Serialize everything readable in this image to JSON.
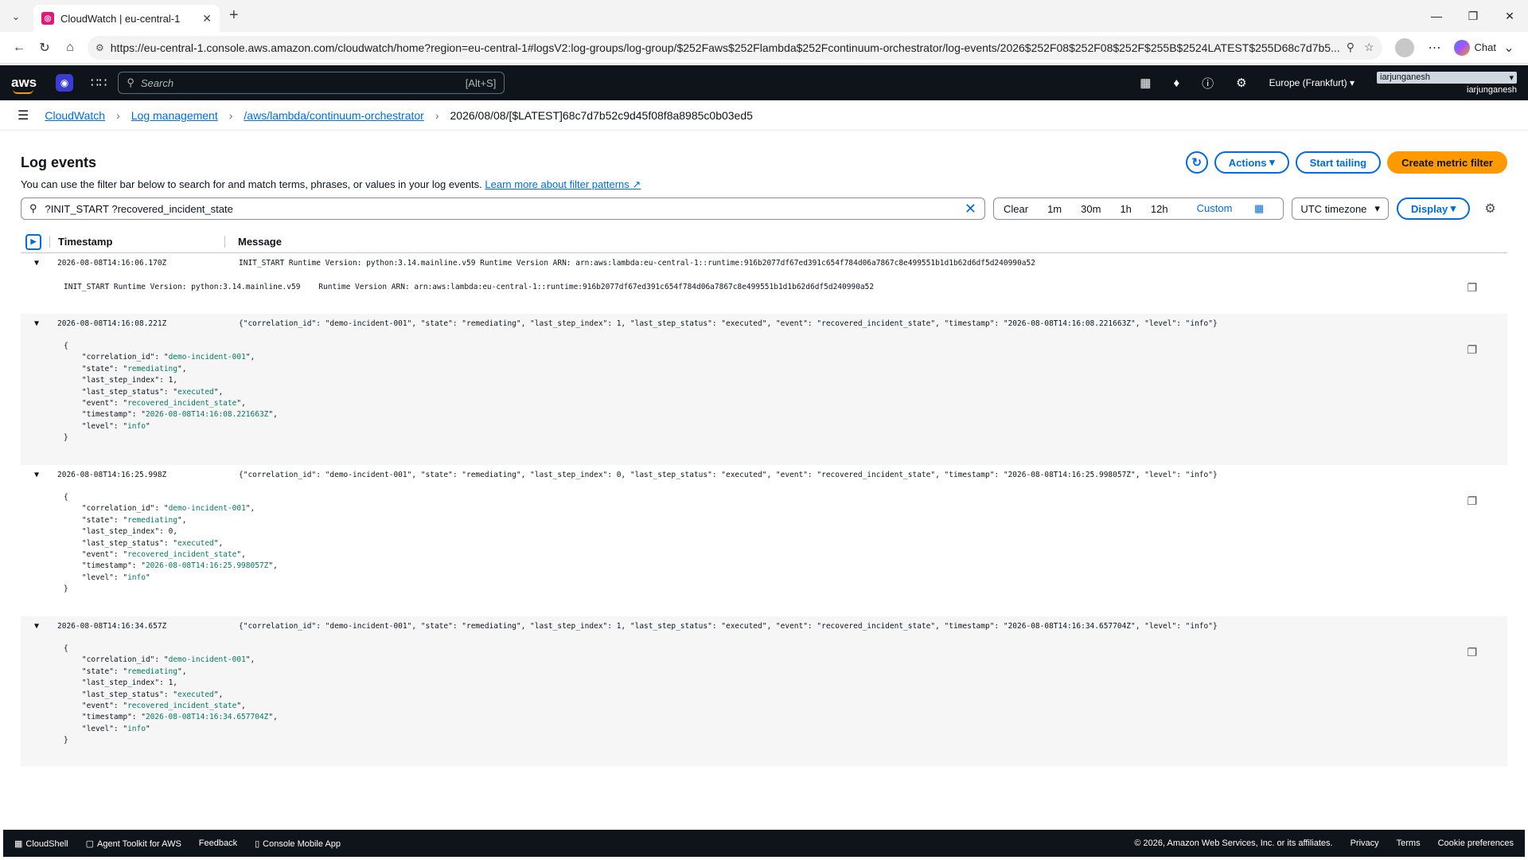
{
  "browser": {
    "tab_title": "CloudWatch | eu-central-1",
    "url": "https://eu-central-1.console.aws.amazon.com/cloudwatch/home?region=eu-central-1#logsV2:log-groups/log-group/$252Faws$252Flambda$252Fcontinuum-orchestrator/log-events/2026$252F08$252F08$252F$255B$2524LATEST$255D68c7d7b5...",
    "chat_label": "Chat"
  },
  "aws": {
    "logo": "aws",
    "search_placeholder": "Search",
    "search_hint": "[Alt+S]",
    "region": "Europe (Frankfurt)",
    "account_badge": "iarjunganesh",
    "account_name": "iarjunganesh"
  },
  "breadcrumb": {
    "items": [
      "CloudWatch",
      "Log management",
      "/aws/lambda/continuum-orchestrator"
    ],
    "current": "2026/08/08/[$LATEST]68c7d7b52c9d45f08f8a8985c0b03ed5"
  },
  "page": {
    "title": "Log events",
    "description": "You can use the filter bar below to search for and match terms, phrases, or values in your log events.",
    "learn_more": "Learn more about filter patterns",
    "actions_label": "Actions",
    "start_tailing_label": "Start tailing",
    "create_metric_label": "Create metric filter",
    "filter_value": "?INIT_START ?recovered_incident_state",
    "time_options": [
      "Clear",
      "1m",
      "30m",
      "1h",
      "12h"
    ],
    "custom_label": "Custom",
    "timezone_label": "UTC timezone",
    "display_label": "Display",
    "col_timestamp": "Timestamp",
    "col_message": "Message"
  },
  "events": [
    {
      "timestamp": "2026-08-08T14:16:06.170Z",
      "message": "INIT_START Runtime Version: python:3.14.mainline.v59 Runtime Version ARN: arn:aws:lambda:eu-central-1::runtime:916b2077df67ed391c654f784d06a7867c8e499551b1d1b62d6df5d240990a52",
      "body": "INIT_START Runtime Version: python:3.14.mainline.v59    Runtime Version ARN: arn:aws:lambda:eu-central-1::runtime:916b2077df67ed391c654f784d06a7867c8e499551b1d1b62d6df5d240990a52"
    },
    {
      "timestamp": "2026-08-08T14:16:08.221Z",
      "message": "{\"correlation_id\": \"demo-incident-001\", \"state\": \"remediating\", \"last_step_index\": 1, \"last_step_status\": \"executed\", \"event\": \"recovered_incident_state\", \"timestamp\": \"2026-08-08T14:16:08.221663Z\", \"level\": \"info\"}",
      "json": {
        "correlation_id": "demo-incident-001",
        "state": "remediating",
        "last_step_index": "1",
        "last_step_status": "executed",
        "event": "recovered_incident_state",
        "timestamp": "2026-08-08T14:16:08.221663Z",
        "level": "info"
      }
    },
    {
      "timestamp": "2026-08-08T14:16:25.998Z",
      "message": "{\"correlation_id\": \"demo-incident-001\", \"state\": \"remediating\", \"last_step_index\": 0, \"last_step_status\": \"executed\", \"event\": \"recovered_incident_state\", \"timestamp\": \"2026-08-08T14:16:25.998057Z\", \"level\": \"info\"}",
      "json": {
        "correlation_id": "demo-incident-001",
        "state": "remediating",
        "last_step_index": "0",
        "last_step_status": "executed",
        "event": "recovered_incident_state",
        "timestamp": "2026-08-08T14:16:25.998057Z",
        "level": "info"
      }
    },
    {
      "timestamp": "2026-08-08T14:16:34.657Z",
      "message": "{\"correlation_id\": \"demo-incident-001\", \"state\": \"remediating\", \"last_step_index\": 1, \"last_step_status\": \"executed\", \"event\": \"recovered_incident_state\", \"timestamp\": \"2026-08-08T14:16:34.657704Z\", \"level\": \"info\"}",
      "json": {
        "correlation_id": "demo-incident-001",
        "state": "remediating",
        "last_step_index": "1",
        "last_step_status": "executed",
        "event": "recovered_incident_state",
        "timestamp": "2026-08-08T14:16:34.657704Z",
        "level": "info"
      }
    }
  ],
  "footer": {
    "left": [
      "CloudShell",
      "Agent Toolkit for AWS",
      "Feedback",
      "Console Mobile App"
    ],
    "copyright": "© 2026, Amazon Web Services, Inc. or its affiliates.",
    "right": [
      "Privacy",
      "Terms",
      "Cookie preferences"
    ]
  },
  "colors": {
    "accent": "#006ce0",
    "primary": "#ff9900",
    "nav": "#0f141a",
    "string": "#007a5e"
  }
}
